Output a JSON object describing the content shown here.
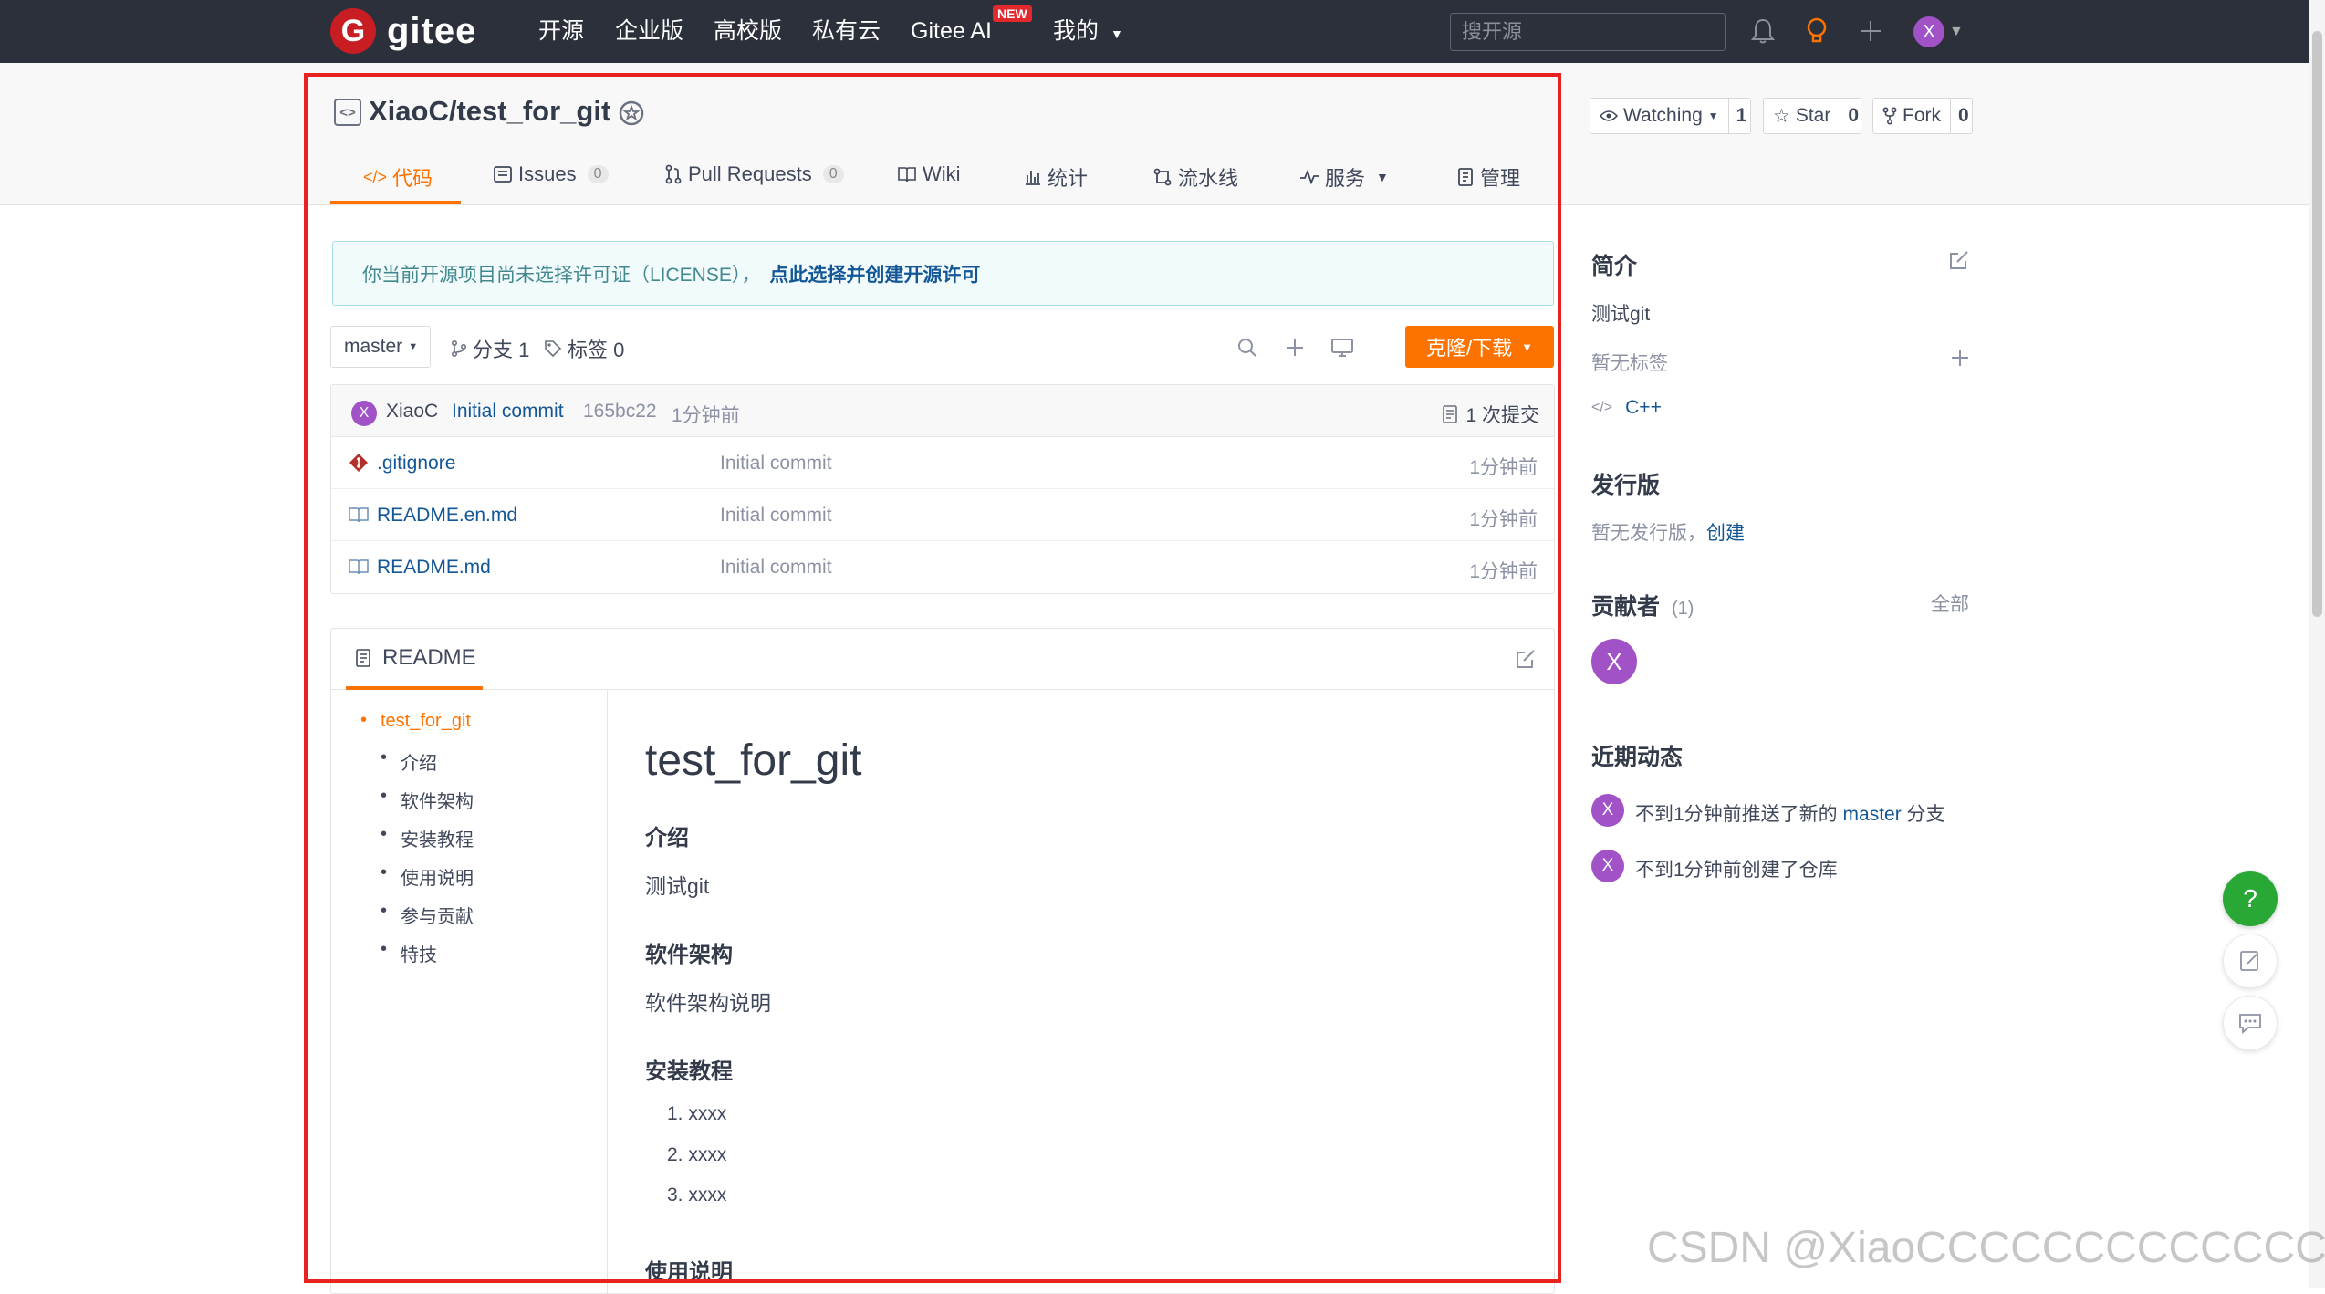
{
  "navbar": {
    "logo_mark": "G",
    "logo_text": "gitee",
    "items": [
      "开源",
      "企业版",
      "高校版",
      "私有云",
      "Gitee AI",
      "我的"
    ],
    "new_badge": "NEW",
    "search_placeholder": "搜开源",
    "avatar_letter": "X"
  },
  "repo": {
    "title": "XiaoC/test_for_git",
    "watch_label": "Watching",
    "watch_count": "1",
    "star_label": "Star",
    "star_count": "0",
    "fork_label": "Fork",
    "fork_count": "0"
  },
  "tabs": {
    "code": "代码",
    "issues": "Issues",
    "issues_count": "0",
    "pulls": "Pull Requests",
    "pulls_count": "0",
    "wiki": "Wiki",
    "stats": "统计",
    "pipeline": "流水线",
    "services": "服务",
    "manage": "管理"
  },
  "license_alert": {
    "text": "你当前开源项目尚未选择许可证（LICENSE），",
    "link": "点此选择并创建开源许可"
  },
  "toolbar": {
    "branch": "master",
    "branches": "分支 1",
    "tags": "标签 0",
    "clone": "克隆/下载"
  },
  "commit": {
    "avatar_letter": "X",
    "author": "XiaoC",
    "message": "Initial commit",
    "hash": "165bc22",
    "time": "1分钟前",
    "count": "1 次提交"
  },
  "files": [
    {
      "name": ".gitignore",
      "message": "Initial commit",
      "time": "1分钟前"
    },
    {
      "name": "README.en.md",
      "message": "Initial commit",
      "time": "1分钟前"
    },
    {
      "name": "README.md",
      "message": "Initial commit",
      "time": "1分钟前"
    }
  ],
  "readme": {
    "title": "README",
    "toc": [
      "test_for_git",
      "介绍",
      "软件架构",
      "安装教程",
      "使用说明",
      "参与贡献",
      "特技"
    ],
    "h1": "test_for_git",
    "sections": {
      "intro_h": "介绍",
      "intro_p": "测试git",
      "arch_h": "软件架构",
      "arch_p": "软件架构说明",
      "install_h": "安装教程",
      "install_list": [
        "xxxx",
        "xxxx",
        "xxxx"
      ],
      "usage_h": "使用说明"
    }
  },
  "sidebar": {
    "intro_title": "简介",
    "intro_desc": "测试git",
    "no_tags": "暂无标签",
    "language": "C++",
    "release_title": "发行版",
    "no_release": "暂无发行版，",
    "create": "创建",
    "contrib_title": "贡献者",
    "contrib_count": "(1)",
    "all": "全部",
    "contrib_avatar": "X",
    "activity_title": "近期动态",
    "activities": [
      {
        "avatar": "X",
        "prefix": "不到1分钟前推送了新的 ",
        "branch": "master",
        "suffix": " 分支"
      },
      {
        "avatar": "X",
        "text": "不到1分钟前创建了仓库"
      }
    ]
  },
  "fab": {
    "help": "?"
  },
  "watermark": "CSDN @XiaoCCCCCCCCCCCCCCC"
}
